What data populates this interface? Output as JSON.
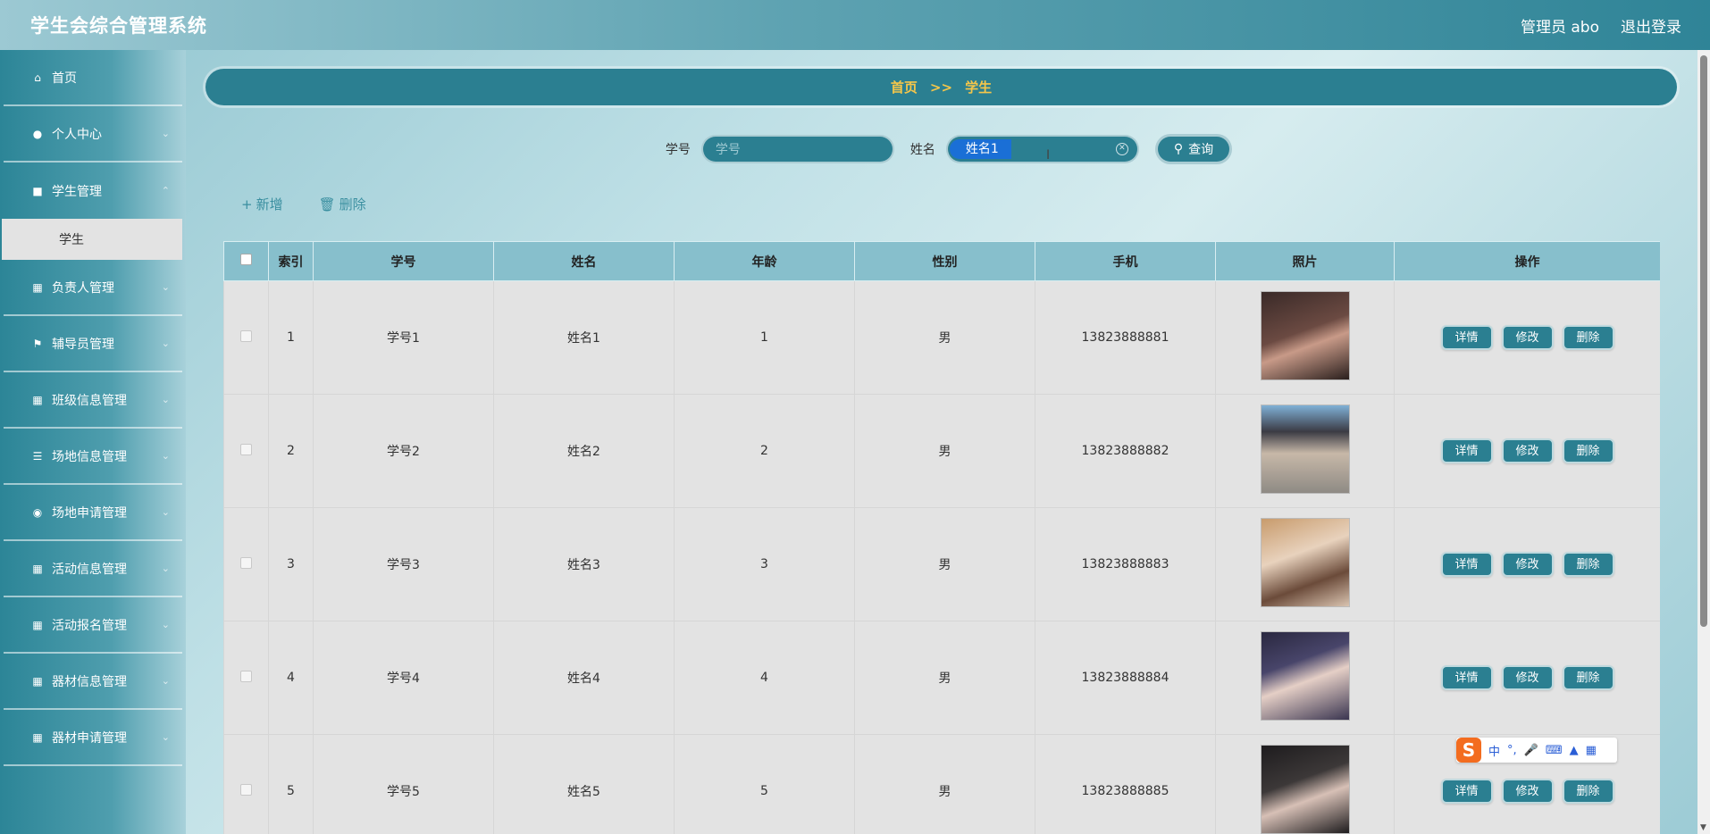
{
  "header": {
    "title": "学生会综合管理系统",
    "user_label": "管理员 abo",
    "logout_label": "退出登录"
  },
  "sidebar": {
    "items": [
      {
        "label": "首页",
        "icon": "home-icon",
        "has_children": false
      },
      {
        "label": "个人中心",
        "icon": "user-icon",
        "has_children": true
      },
      {
        "label": "学生管理",
        "icon": "chat-icon",
        "has_children": true
      },
      {
        "label": "负责人管理",
        "icon": "grid-icon",
        "has_children": true
      },
      {
        "label": "辅导员管理",
        "icon": "flag-icon",
        "has_children": true
      },
      {
        "label": "班级信息管理",
        "icon": "grid-icon",
        "has_children": true
      },
      {
        "label": "场地信息管理",
        "icon": "list-icon",
        "has_children": true
      },
      {
        "label": "场地申请管理",
        "icon": "pin-icon",
        "has_children": true
      },
      {
        "label": "活动信息管理",
        "icon": "grid-icon",
        "has_children": true
      },
      {
        "label": "活动报名管理",
        "icon": "grid-icon",
        "has_children": true
      },
      {
        "label": "器材信息管理",
        "icon": "grid-icon",
        "has_children": true
      },
      {
        "label": "器材申请管理",
        "icon": "grid-icon",
        "has_children": true
      }
    ],
    "active_submenu": "学生"
  },
  "breadcrumb": {
    "home": "首页",
    "sep": ">>",
    "current": "学生"
  },
  "search": {
    "student_id_label": "学号",
    "student_id_placeholder": "学号",
    "name_label": "姓名",
    "name_value": "姓名1",
    "query_label": "查询"
  },
  "actions": {
    "add_label": "新增",
    "delete_label": "删除"
  },
  "table": {
    "headers": [
      "索引",
      "学号",
      "姓名",
      "年龄",
      "性别",
      "手机",
      "照片",
      "操作"
    ],
    "rows": [
      {
        "index": "1",
        "sid": "学号1",
        "name": "姓名1",
        "age": "1",
        "gender": "男",
        "phone": "13823888881"
      },
      {
        "index": "2",
        "sid": "学号2",
        "name": "姓名2",
        "age": "2",
        "gender": "男",
        "phone": "13823888882"
      },
      {
        "index": "3",
        "sid": "学号3",
        "name": "姓名3",
        "age": "3",
        "gender": "男",
        "phone": "13823888883"
      },
      {
        "index": "4",
        "sid": "学号4",
        "name": "姓名4",
        "age": "4",
        "gender": "男",
        "phone": "13823888884"
      },
      {
        "index": "5",
        "sid": "学号5",
        "name": "姓名5",
        "age": "5",
        "gender": "男",
        "phone": "13823888885"
      }
    ],
    "op_detail": "详情",
    "op_edit": "修改",
    "op_delete": "删除"
  },
  "ime": {
    "lang": "中",
    "punct": "°,"
  },
  "colors": {
    "primary": "#2b7f91",
    "breadcrumb_text": "#f5c64a",
    "header_row": "#87bfcc"
  }
}
